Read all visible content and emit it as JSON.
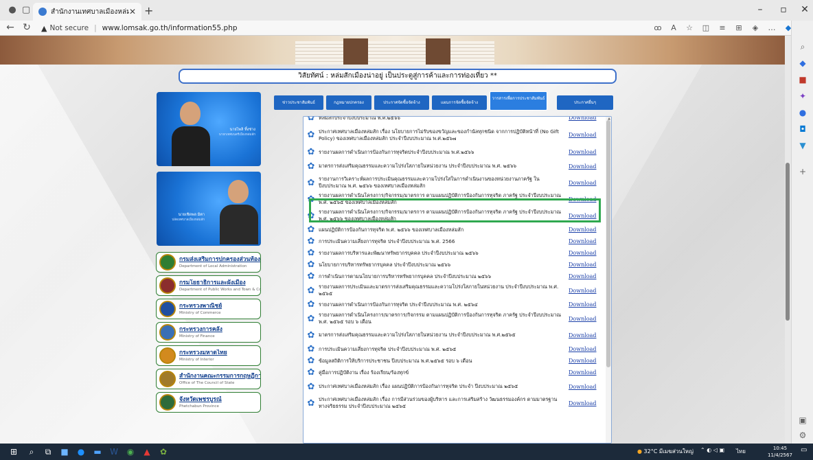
{
  "browser": {
    "tab_title": "สำนักงานเทศบาลเมืองหล่มสัก",
    "new_tab": "+",
    "not_secure": "Not secure",
    "url": "www.lomsak.go.th/information55.php"
  },
  "page": {
    "slogan": "วิสัยทัศน์ : หล่มสักเมืองน่าอยู่ เป็นประตูสู่การค้าและการท่องเที่ยว **",
    "person1": {
      "name": "นายไพลิ ทิ้งช่าง",
      "role": "นายกเทศมนตรีเมืองหล่มสัก"
    },
    "person2": {
      "name": "นายเชิดพล มิตา",
      "role": "ปลัดเทศบาลเมืองหล่มสัก"
    },
    "tabs": [
      "ข่าวประชาสัมพันธ์",
      "กฎหมายปกครอง",
      "ประกาศจัดซื้อจัดจ้าง",
      "แผนการจัดซื้อจัดจ้าง",
      "วารสารเพื่อการประชาสัมพันธ์",
      "ประกาศอื่นๆ"
    ],
    "agencies": [
      {
        "name": "กรมส่งเสริมการปกครองส่วนท้องถิ่น",
        "sub": "Department of Local Administration"
      },
      {
        "name": "กรมโยธาธิการและผังเมือง",
        "sub": "Department of Public Works and Town & Country Planning"
      },
      {
        "name": "กระทรวงพาณิชย์",
        "sub": "Ministry of Commerce"
      },
      {
        "name": "กระทรวงการคลัง",
        "sub": "Ministry of Finance"
      },
      {
        "name": "กระทรวงมหาดไทย",
        "sub": "Ministry of Interior"
      },
      {
        "name": "สำนักงานคณะกรรมการกฤษฎีกา",
        "sub": "Office of The Council of State"
      },
      {
        "name": "จังหวัดเพชรบูรณ์",
        "sub": "Phetchabun Province"
      }
    ],
    "download_label": "Download",
    "documents": [
      {
        "title": "หล่มสักประจำปีงบประมาณ พ.ศ.๒๕๖๖",
        "h": "h1",
        "dl": true
      },
      {
        "title": "ประกาศเทศบาลเมืองหล่มสัก เรื่อง นโยบายการไม่รับของขวัญและของกำนัลทุกชนิด จากการปฏิบัติหน้าที่ (No Gift Policy) ของเทศบาลเมืองหล่มสัก ประจำปีงบประมาณ พ.ศ.๒๕๖๗",
        "h": "h3",
        "dl": true
      },
      {
        "title": "รายงานผลการดำเนินการป้องกันการทุจริตประจำปีงบประมาณ พ.ศ.๒๕๖๖",
        "h": "h1",
        "dl": true
      },
      {
        "title": "มาตรการส่งเสริมคุณธรรมและความโปร่งใสภายในหน่วยงาน ประจำปีงบประมาณ พ.ศ. ๒๕๖๖",
        "h": "h2",
        "dl": true
      },
      {
        "title": "รายงานการวิเคราะห์ผลการประเมินคุณธรรมและความโปร่งใสในการดำเนินงานของหน่วยงานภาครัฐ ในปีงบประมาณ พ.ศ. ๒๕๖๖ ของเทศบาลเมืองหล่มสัก",
        "h": "h2",
        "dl": true
      },
      {
        "title": "รายงานผลการดำเนินโครงการ/กิจกรรม/มาตรการ ตามแผนปฏิบัติการป้องกันการทุจริต ภาครัฐ ประจำปีงบประมาณ พ.ศ. ๒๕๖๕ ของเทศบาลเมืองหล่มสัก",
        "h": "h2",
        "dl": true
      },
      {
        "title": "รายงานผลการดำเนินโครงการ/กิจกรรม/มาตรการ ตามแผนปฏิบัติการป้องกันการทุจริต ภาครัฐ ประจำปีงบประมาณ พ.ศ. ๒๕๖๖ ของเทศบาลเมืองหล่มสัก",
        "h": "h2",
        "dl": true
      },
      {
        "title": "แผนปฏิบัติการป้องกันการทุจริต พ.ศ. ๒๕๖๖ ของเทศบาลเมืองหล่มสัก",
        "h": "h1",
        "dl": true
      },
      {
        "title": "การประเมินความเสี่ยงการทุจริต ประจำปีงบประมาณ พ.ศ. 2566",
        "h": "h1",
        "dl": true
      },
      {
        "title": "รายงานผลการบริหารและพัฒนาทรัพยากรบุคคล ประจำปีงบประมาณ ๒๕๖๖",
        "h": "h1",
        "dl": true
      },
      {
        "title": "นโยบายการบริหารทรัพยากรบุคคล ประจำปีงบประมาณ ๒๕๖๖",
        "h": "h1",
        "dl": true
      },
      {
        "title": "การดำเนินการตามนโยบายการบริหารทรัพยากรบุคคล ประจำปีงบประมาณ ๒๕๖๖",
        "h": "h1",
        "dl": true
      },
      {
        "title": "รายงานผลการประเมินและมาตรการส่งเสริมคุณธรรมและความโปร่งใสภายในหน่วยงาน ประจำปีงบประมาณ พ.ศ. ๒๕๖๕",
        "h": "h2",
        "dl": true
      },
      {
        "title": "รายงานผลการดำเนินการป้องกันการทุจริต ประจำปีงบประมาณ พ.ศ. ๒๕๖๔",
        "h": "h1",
        "dl": true
      },
      {
        "title": "รายงานผลการดำเนินโครงการ/มาตรการ/กิจกรรม ตามแผนปฏิบัติการป้องกันการทุจริต ภาครัฐ ประจำปีงบประมาณ พ.ศ. ๒๕๖๕ รอบ ๖ เดือน",
        "h": "h2",
        "dl": true
      },
      {
        "title": "มาตรการส่งเสริมคุณธรรมและความโปร่งใสภายในหน่วยงาน ประจำปีงบประมาณ พ.ศ.๒๕๖๕",
        "h": "h2",
        "dl": true
      },
      {
        "title": "การประเมินความเสี่ยงการทุจริต ประจำปีงบประมาณ พ.ศ. ๒๕๖๕",
        "h": "h1",
        "dl": true
      },
      {
        "title": "ข้อมูลสถิติการให้บริการประชาชน ปีงบประมาณ พ.ศ.๒๕๖๕ รอบ ๖ เดือน",
        "h": "h1",
        "dl": true
      },
      {
        "title": "คู่มือการปฏิบัติงาน เรื่อง ร้องเรียน/ร้องทุกข์",
        "h": "h1",
        "dl": true
      },
      {
        "title": "ประกาศเทศบาลเมืองหล่มสัก เรื่อง แผนปฏิบัติการป้องกันการทุจริต ประจำ ปีงบประมาณ ๒๕๖๕",
        "h": "h2",
        "dl": true
      },
      {
        "title": "ประกาศเทศบาลเมืองหล่มสัก เรื่อง การมีส่วนร่วมของผู้บริหาร และการเสริมสร้าง วัฒนธรรมองค์กร ตามมาตรฐานทางจริยธรรม ประจำปีงบประมาณ ๒๕๖๕",
        "h": "h2",
        "dl": true
      }
    ]
  },
  "taskbar": {
    "weather": "32°C มีเมฆส่วนใหญ่",
    "lang": "ไทย",
    "time": "10:45",
    "date": "11/4/2567"
  },
  "colors": {
    "accent": "#1f66c2",
    "highlight": "#2fa84f",
    "link": "#1a3fa8"
  }
}
